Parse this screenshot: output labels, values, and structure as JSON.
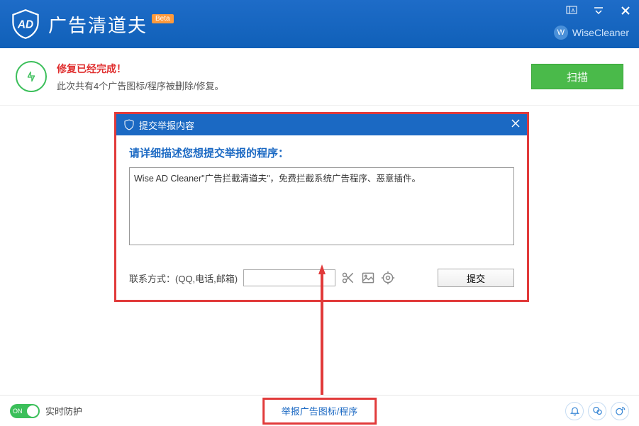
{
  "header": {
    "title": "广告清道夫",
    "badge": "Beta",
    "brand": "WiseCleaner",
    "brand_initial": "W"
  },
  "status": {
    "title": "修复已经完成！",
    "subtitle": "此次共有4个广告图标/程序被删除/修复。",
    "scan_btn": "扫描"
  },
  "dialog": {
    "title": "提交举报内容",
    "heading": "请详细描述您想提交举报的程序：",
    "textarea_value": "Wise AD Cleaner\"广告拦截清道夫\"，免费拦截系统广告程序、恶意插件。",
    "contact_label": "联系方式：(QQ,电话,邮箱)",
    "submit_btn": "提交"
  },
  "bottom": {
    "toggle_on": "ON",
    "toggle_label": "实时防护",
    "report_link": "举报广告图标/程序"
  }
}
